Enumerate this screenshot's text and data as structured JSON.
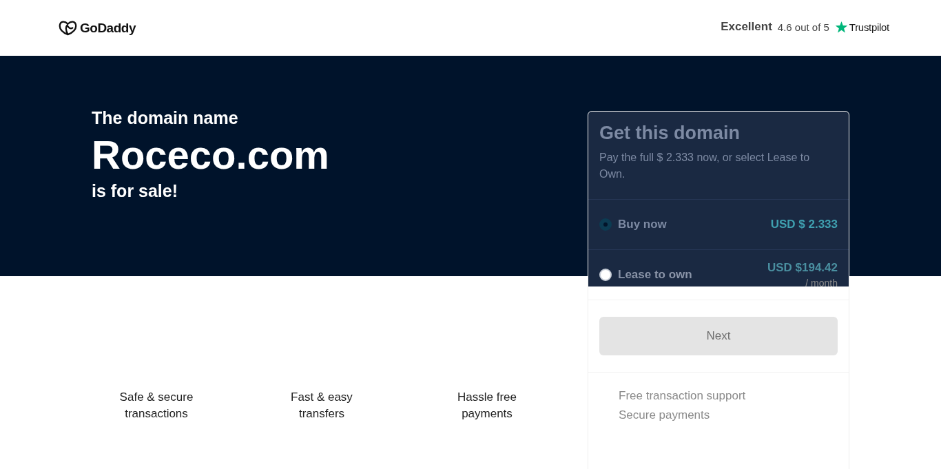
{
  "header": {
    "logo": "GoDaddy",
    "rating": {
      "label": "Excellent",
      "score": "4.6 out of 5",
      "brand": "Trustpilot"
    }
  },
  "hero": {
    "intro": "The domain name",
    "domain": "Roceco.com",
    "outro": "is for sale!"
  },
  "features": [
    "Safe & secure transactions",
    "Fast & easy transfers",
    "Hassle free payments"
  ],
  "card": {
    "title": "Get this domain",
    "description": "Pay the full $ 2.333 now, or select Lease to Own.",
    "options": [
      {
        "label": "Buy now",
        "price": "USD $ 2.333",
        "selected": true
      },
      {
        "label": "Lease to own",
        "price": "USD $194.42",
        "period": "/ month",
        "selected": false
      }
    ],
    "button": "Next",
    "perks": [
      "Free transaction support",
      "Secure payments"
    ]
  }
}
